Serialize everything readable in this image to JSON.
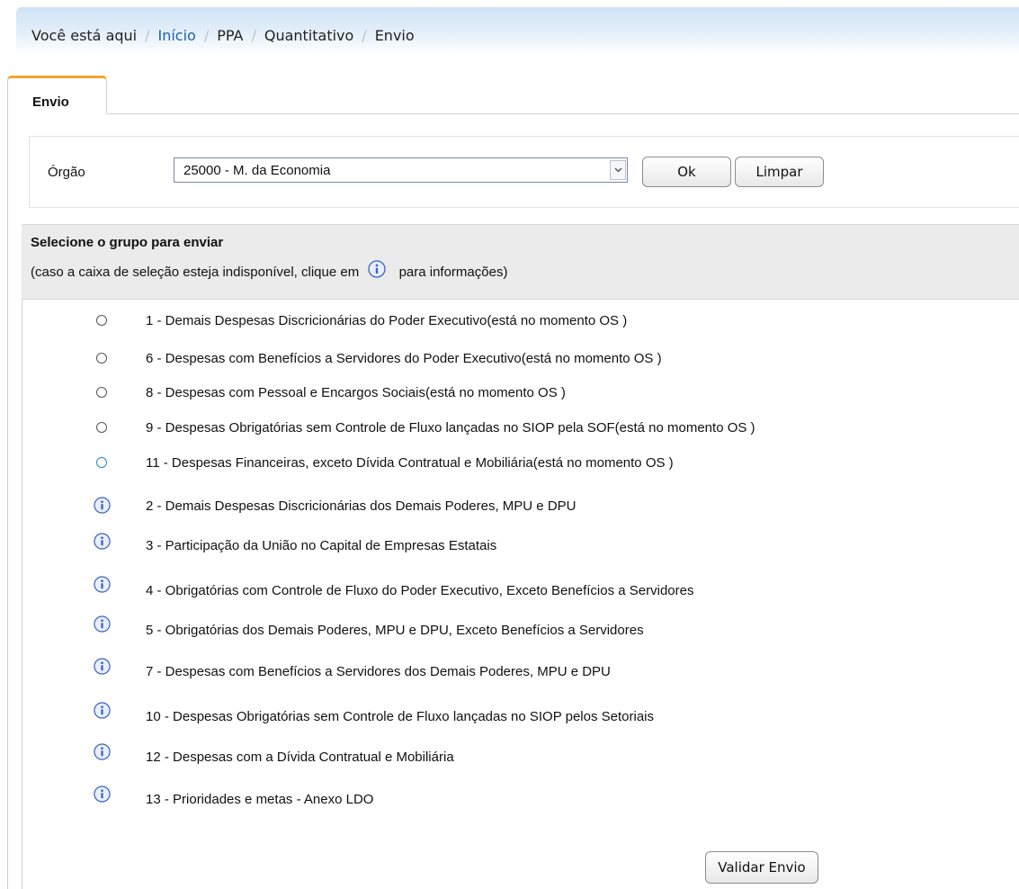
{
  "breadcrumb": {
    "prefix": "Você está aqui",
    "items": [
      "Início",
      "PPA",
      "Quantitativo",
      "Envio"
    ]
  },
  "tab": {
    "label": "Envio"
  },
  "filter": {
    "orgao_label": "Órgão",
    "orgao_value": "25000 - M. da Economia",
    "ok_label": "Ok",
    "limpar_label": "Limpar"
  },
  "group_section": {
    "title": "Selecione o grupo para enviar",
    "subtitle_before": "(caso a caixa de seleção esteja indisponível, clique em",
    "subtitle_after": "para informações)"
  },
  "radio_groups": [
    {
      "label": "1 - Demais Despesas Discricionárias do Poder Executivo(está no momento OS )"
    },
    {
      "label": "6 - Despesas com Benefícios a Servidores do Poder Executivo(está no momento OS )"
    },
    {
      "label": "8 - Despesas com Pessoal e Encargos Sociais(está no momento OS )"
    },
    {
      "label": "9 - Despesas Obrigatórias sem Controle de Fluxo lançadas no SIOP pela SOF(está no momento OS )"
    },
    {
      "label": "11 - Despesas Financeiras, exceto Dívida Contratual e Mobiliária(está no momento OS )"
    }
  ],
  "info_groups": [
    {
      "label": "2 - Demais Despesas Discricionárias dos Demais Poderes, MPU e DPU"
    },
    {
      "label": "3 - Participação da União no Capital de Empresas Estatais"
    },
    {
      "label": "4 - Obrigatórias com Controle de Fluxo do Poder Executivo, Exceto Benefícios a Servidores"
    },
    {
      "label": "5 - Obrigatórias dos Demais Poderes, MPU e DPU, Exceto Benefícios a Servidores"
    },
    {
      "label": "7 - Despesas com Benefícios a Servidores dos Demais Poderes, MPU e DPU"
    },
    {
      "label": "10 - Despesas Obrigatórias sem Controle de Fluxo lançadas no SIOP pelos Setoriais"
    },
    {
      "label": "12 - Despesas com a Dívida Contratual e Mobiliária"
    },
    {
      "label": "13 - Prioridades e metas - Anexo LDO"
    }
  ],
  "actions": {
    "validar_label": "Validar Envio"
  },
  "colors": {
    "link": "#1f5fa8",
    "tab_accent": "#f2a52c",
    "info_icon": "#3b63c4",
    "header_bg": "#ebebeb"
  }
}
